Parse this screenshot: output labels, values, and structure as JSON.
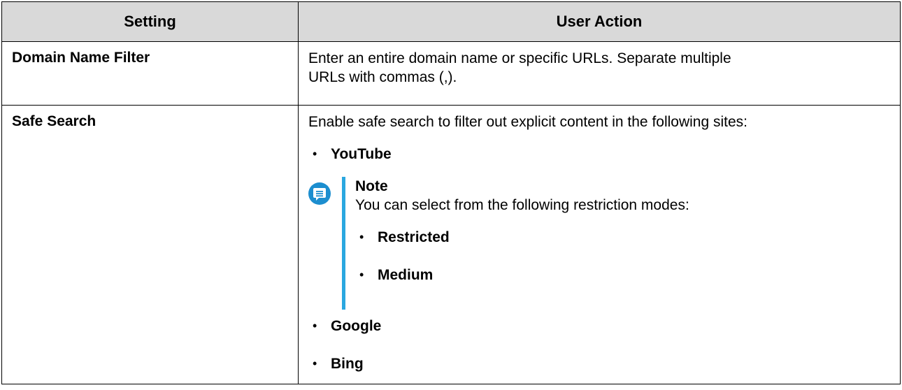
{
  "table": {
    "headers": {
      "setting": "Setting",
      "user_action": "User Action"
    },
    "rows": [
      {
        "setting": "Domain Name Filter",
        "action_line1": "Enter an entire domain name or specific URLs. Separate multiple",
        "action_line2": "URLs with commas (,)."
      },
      {
        "setting": "Safe Search",
        "action_intro": "Enable safe search to filter out explicit content in the following sites:",
        "sites": [
          "YouTube",
          "Google",
          "Bing"
        ],
        "note": {
          "title": "Note",
          "text": "You can select from the following restriction modes:",
          "modes": [
            "Restricted",
            "Medium"
          ]
        }
      }
    ]
  },
  "colors": {
    "header_bg": "#d9d9d9",
    "note_icon": "#1c8ecf",
    "note_bar": "#2aa7e0"
  },
  "icons": {
    "note": "note-speech-bubble-icon",
    "bullet": "•"
  }
}
